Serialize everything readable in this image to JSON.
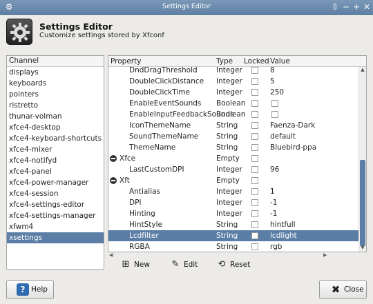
{
  "window": {
    "title": "Settings Editor"
  },
  "header": {
    "title": "Settings Editor",
    "subtitle": "Customize settings stored by Xfconf"
  },
  "channels": {
    "header": "Channel",
    "items": [
      "displays",
      "keyboards",
      "pointers",
      "ristretto",
      "thunar-volman",
      "xfce4-desktop",
      "xfce4-keyboard-shortcuts",
      "xfce4-mixer",
      "xfce4-notifyd",
      "xfce4-panel",
      "xfce4-power-manager",
      "xfce4-session",
      "xfce4-settings-editor",
      "xfce4-settings-manager",
      "xfwm4",
      "xsettings"
    ],
    "selected": "xsettings"
  },
  "properties": {
    "columns": {
      "property": "Property",
      "type": "Type",
      "locked": "Locked",
      "value": "Value"
    },
    "rows": [
      {
        "name": "DndDragThreshold",
        "type": "Integer",
        "value": "8"
      },
      {
        "name": "DoubleClickDistance",
        "type": "Integer",
        "value": "5"
      },
      {
        "name": "DoubleClickTime",
        "type": "Integer",
        "value": "250"
      },
      {
        "name": "EnableEventSounds",
        "type": "Boolean",
        "value": ""
      },
      {
        "name": "EnableInputFeedbackSounds",
        "type": "Boolean",
        "value": ""
      },
      {
        "name": "IconThemeName",
        "type": "String",
        "value": "Faenza-Dark"
      },
      {
        "name": "SoundThemeName",
        "type": "String",
        "value": "default"
      },
      {
        "name": "ThemeName",
        "type": "String",
        "value": "Bluebird-ppa"
      },
      {
        "name": "Xfce",
        "type": "Empty",
        "value": ""
      },
      {
        "name": "LastCustomDPI",
        "type": "Integer",
        "value": "96"
      },
      {
        "name": "Xft",
        "type": "Empty",
        "value": ""
      },
      {
        "name": "Antialias",
        "type": "Integer",
        "value": "1"
      },
      {
        "name": "DPI",
        "type": "Integer",
        "value": "-1"
      },
      {
        "name": "Hinting",
        "type": "Integer",
        "value": "-1"
      },
      {
        "name": "HintStyle",
        "type": "String",
        "value": "hintfull"
      },
      {
        "name": "Lcdfilter",
        "type": "String",
        "value": "lcdlight"
      },
      {
        "name": "RGBA",
        "type": "String",
        "value": "rgb"
      }
    ],
    "selected": "Lcdfilter"
  },
  "actions": {
    "new": "New",
    "edit": "Edit",
    "reset": "Reset"
  },
  "buttons": {
    "help": "Help",
    "close": "Close"
  },
  "icons": {
    "new": "new-icon",
    "edit": "edit-icon",
    "reset": "reset-icon",
    "help": "help-icon",
    "close": "close-icon"
  },
  "colors": {
    "selection": "#5b7ea6",
    "titlebar": "#6a89ad",
    "help_icon": "#2f6bb0"
  }
}
